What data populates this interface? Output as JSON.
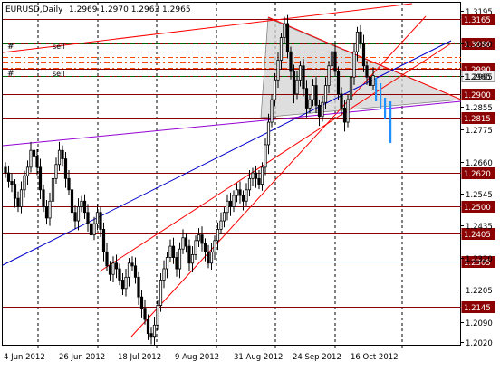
{
  "header": {
    "symbol": "EURUSD,Daily",
    "ohlc": "1.2969 1.2970 1.2963 1.2965"
  },
  "trade_labels": [
    {
      "marker": "#",
      "text": "sell"
    },
    {
      "marker": "#",
      "text": "sell"
    }
  ],
  "x_axis_labels": [
    "4 Jun 2012",
    "26 Jun 2012",
    "18 Jul 2012",
    "9 Aug 2012",
    "31 Aug 2012",
    "24 Sep 2012",
    "16 Oct 2012"
  ],
  "y_axis_ticks": [
    "1.3195",
    "1.3080",
    "1.2965",
    "1.2855",
    "1.2775",
    "1.2660",
    "1.2545",
    "1.2435",
    "1.2320",
    "1.2205",
    "1.2090",
    "1.2020"
  ],
  "price_levels": [
    {
      "value": "1.3165",
      "style": "dark"
    },
    {
      "value": "1.3080",
      "style": "dark"
    },
    {
      "value": "1.2990",
      "style": "dark"
    },
    {
      "value": "1.2965",
      "style": "light"
    },
    {
      "value": "1.2900",
      "style": "dark"
    },
    {
      "value": "1.2815",
      "style": "dark"
    },
    {
      "value": "1.2620",
      "style": "dark"
    },
    {
      "value": "1.2500",
      "style": "dark"
    },
    {
      "value": "1.2405",
      "style": "dark"
    },
    {
      "value": "1.2305",
      "style": "dark"
    },
    {
      "value": "1.2145",
      "style": "dark"
    }
  ],
  "colors": {
    "background": "#ffffff",
    "candles": "#000000",
    "horizontal_levels": "#8b0000",
    "channel_lines": "#ff0000",
    "trend_blue": "#0000cd",
    "trend_violet": "#9400d3",
    "projection": "#1e90ff",
    "triangle_fill": "#d3d3d3",
    "dashed_green": "#006400",
    "dashed_orange": "#ff4500"
  }
}
